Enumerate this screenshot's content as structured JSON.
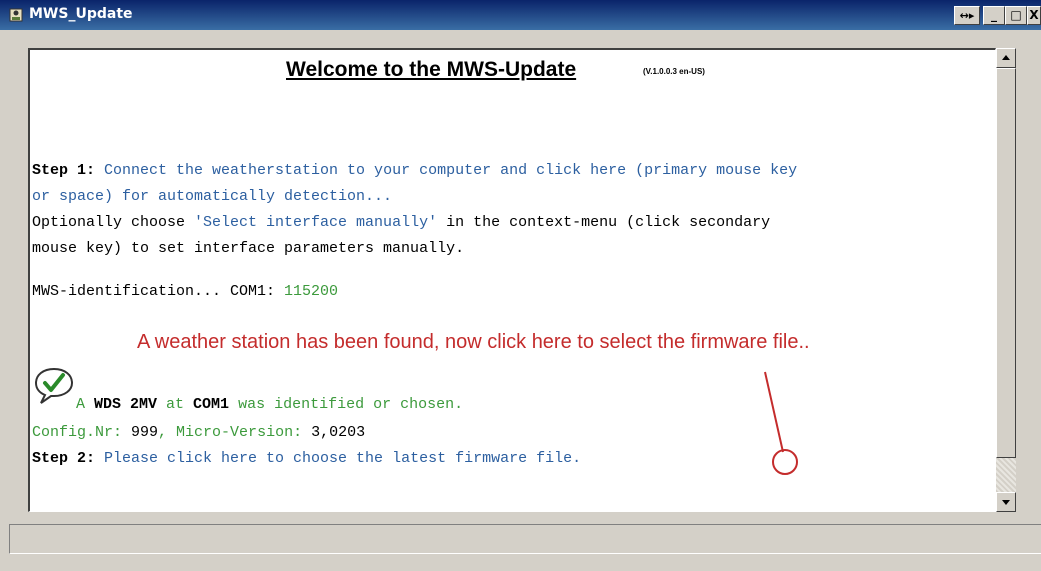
{
  "window": {
    "title": "MWS_Update",
    "buttons": {
      "restore_resize": "↔▸",
      "minimize": "_",
      "maximize": "□",
      "close": "X"
    }
  },
  "content": {
    "heading": "Welcome to the MWS-Update",
    "version": "(V.1.0.0.3 en-US)",
    "step1_label": "Step 1:",
    "step1_text_a": " Connect the weatherstation to your computer and click here (primary mouse key",
    "step1_text_b": "or space) for automatically detection...",
    "optional_a_prefix": "Optionally choose ",
    "optional_a_quoted": "'Select interface manually'",
    "optional_a_suffix": " in the context-menu (click secondary",
    "optional_b": "mouse key) to set interface parameters manually.",
    "ident_prefix": "MWS-identification... COM1: ",
    "ident_baud": "115200",
    "found_a": "A ",
    "found_device": "WDS 2MV",
    "found_b": " at ",
    "found_port": "COM1",
    "found_c": " was identified or chosen.",
    "config_a": "Config.Nr: ",
    "config_nr": "999",
    "config_b": ", Micro-Version: ",
    "micro_version": "3,0203",
    "step2_label": "Step 2:",
    "step2_text": " Please click here to choose the latest firmware file."
  },
  "annotation": {
    "text": "A weather station has been found, now click here to select the firmware file.."
  },
  "icons": {
    "app": "weather-station-icon",
    "check": "checkmark-bubble-icon"
  },
  "colors": {
    "accent_blue": "#2c5fa0",
    "success_green": "#3c9a3c",
    "annotation_red": "#c42c2c"
  }
}
